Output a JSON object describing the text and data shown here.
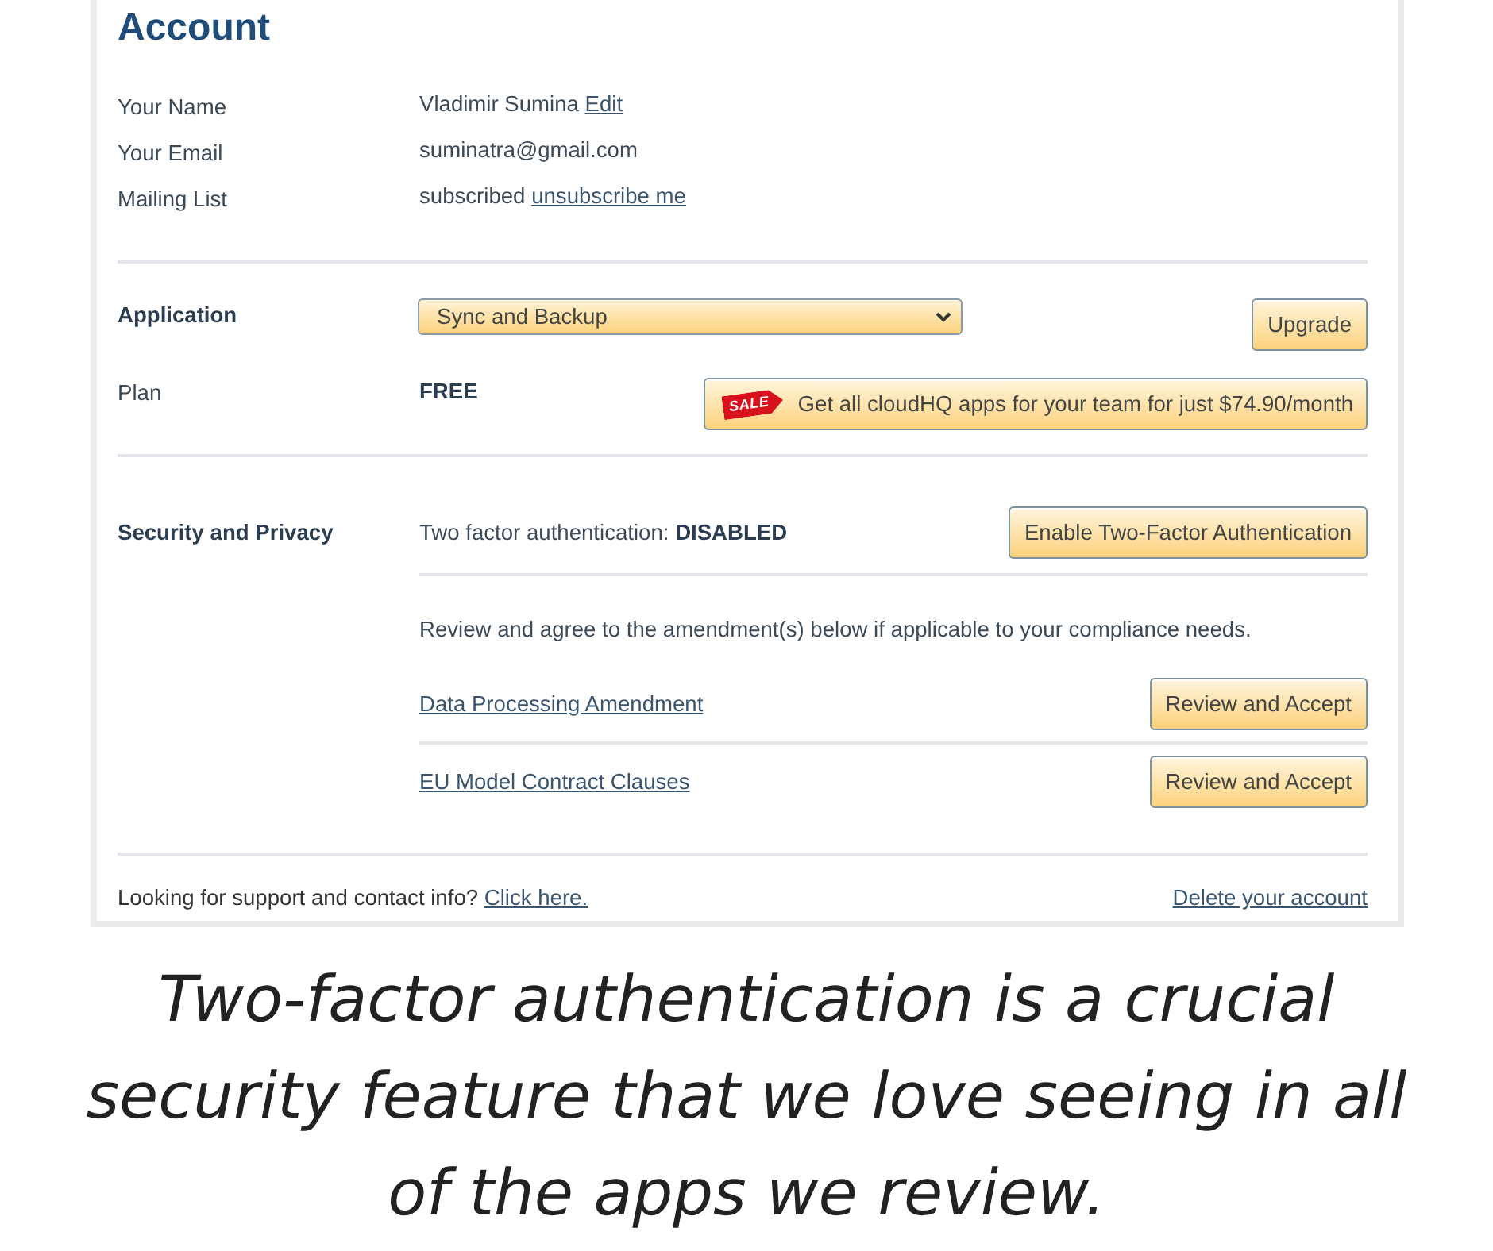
{
  "heading": "Account",
  "profile": [
    {
      "label": "Your Name",
      "value": "Vladimir Sumina",
      "link": "Edit"
    },
    {
      "label": "Your Email",
      "value": "suminatra@gmail.com"
    },
    {
      "label": "Mailing List",
      "value": "subscribed",
      "link": "unsubscribe me"
    }
  ],
  "application": {
    "label": "Application",
    "select": {
      "value": "Sync and Backup"
    },
    "button": "Upgrade"
  },
  "plan": {
    "label": "Plan",
    "value": "FREE",
    "promo": {
      "badge": "SALE",
      "text": "Get all cloudHQ apps for your team for just $74.90/month"
    }
  },
  "security": {
    "label": "Security and Privacy",
    "two_factor": "Two factor authentication: **DISABLED**",
    "button": "Enable Two-Factor Authentication",
    "note": "Review and agree to the amendment(s) below if applicable to your compliance needs.",
    "amendments": [
      {
        "name": "Data Processing Amendment",
        "button": "Review and Accept"
      },
      {
        "name": "EU Model Contract Clauses",
        "button": "Review and Accept"
      }
    ]
  },
  "footer": {
    "support": {
      "text": "Looking for support and contact info?",
      "link": "Click here."
    },
    "delete_link": "Delete your account"
  },
  "caption": "Two-factor authentication is a crucial security feature that we love seeing in all of the apps we review."
}
